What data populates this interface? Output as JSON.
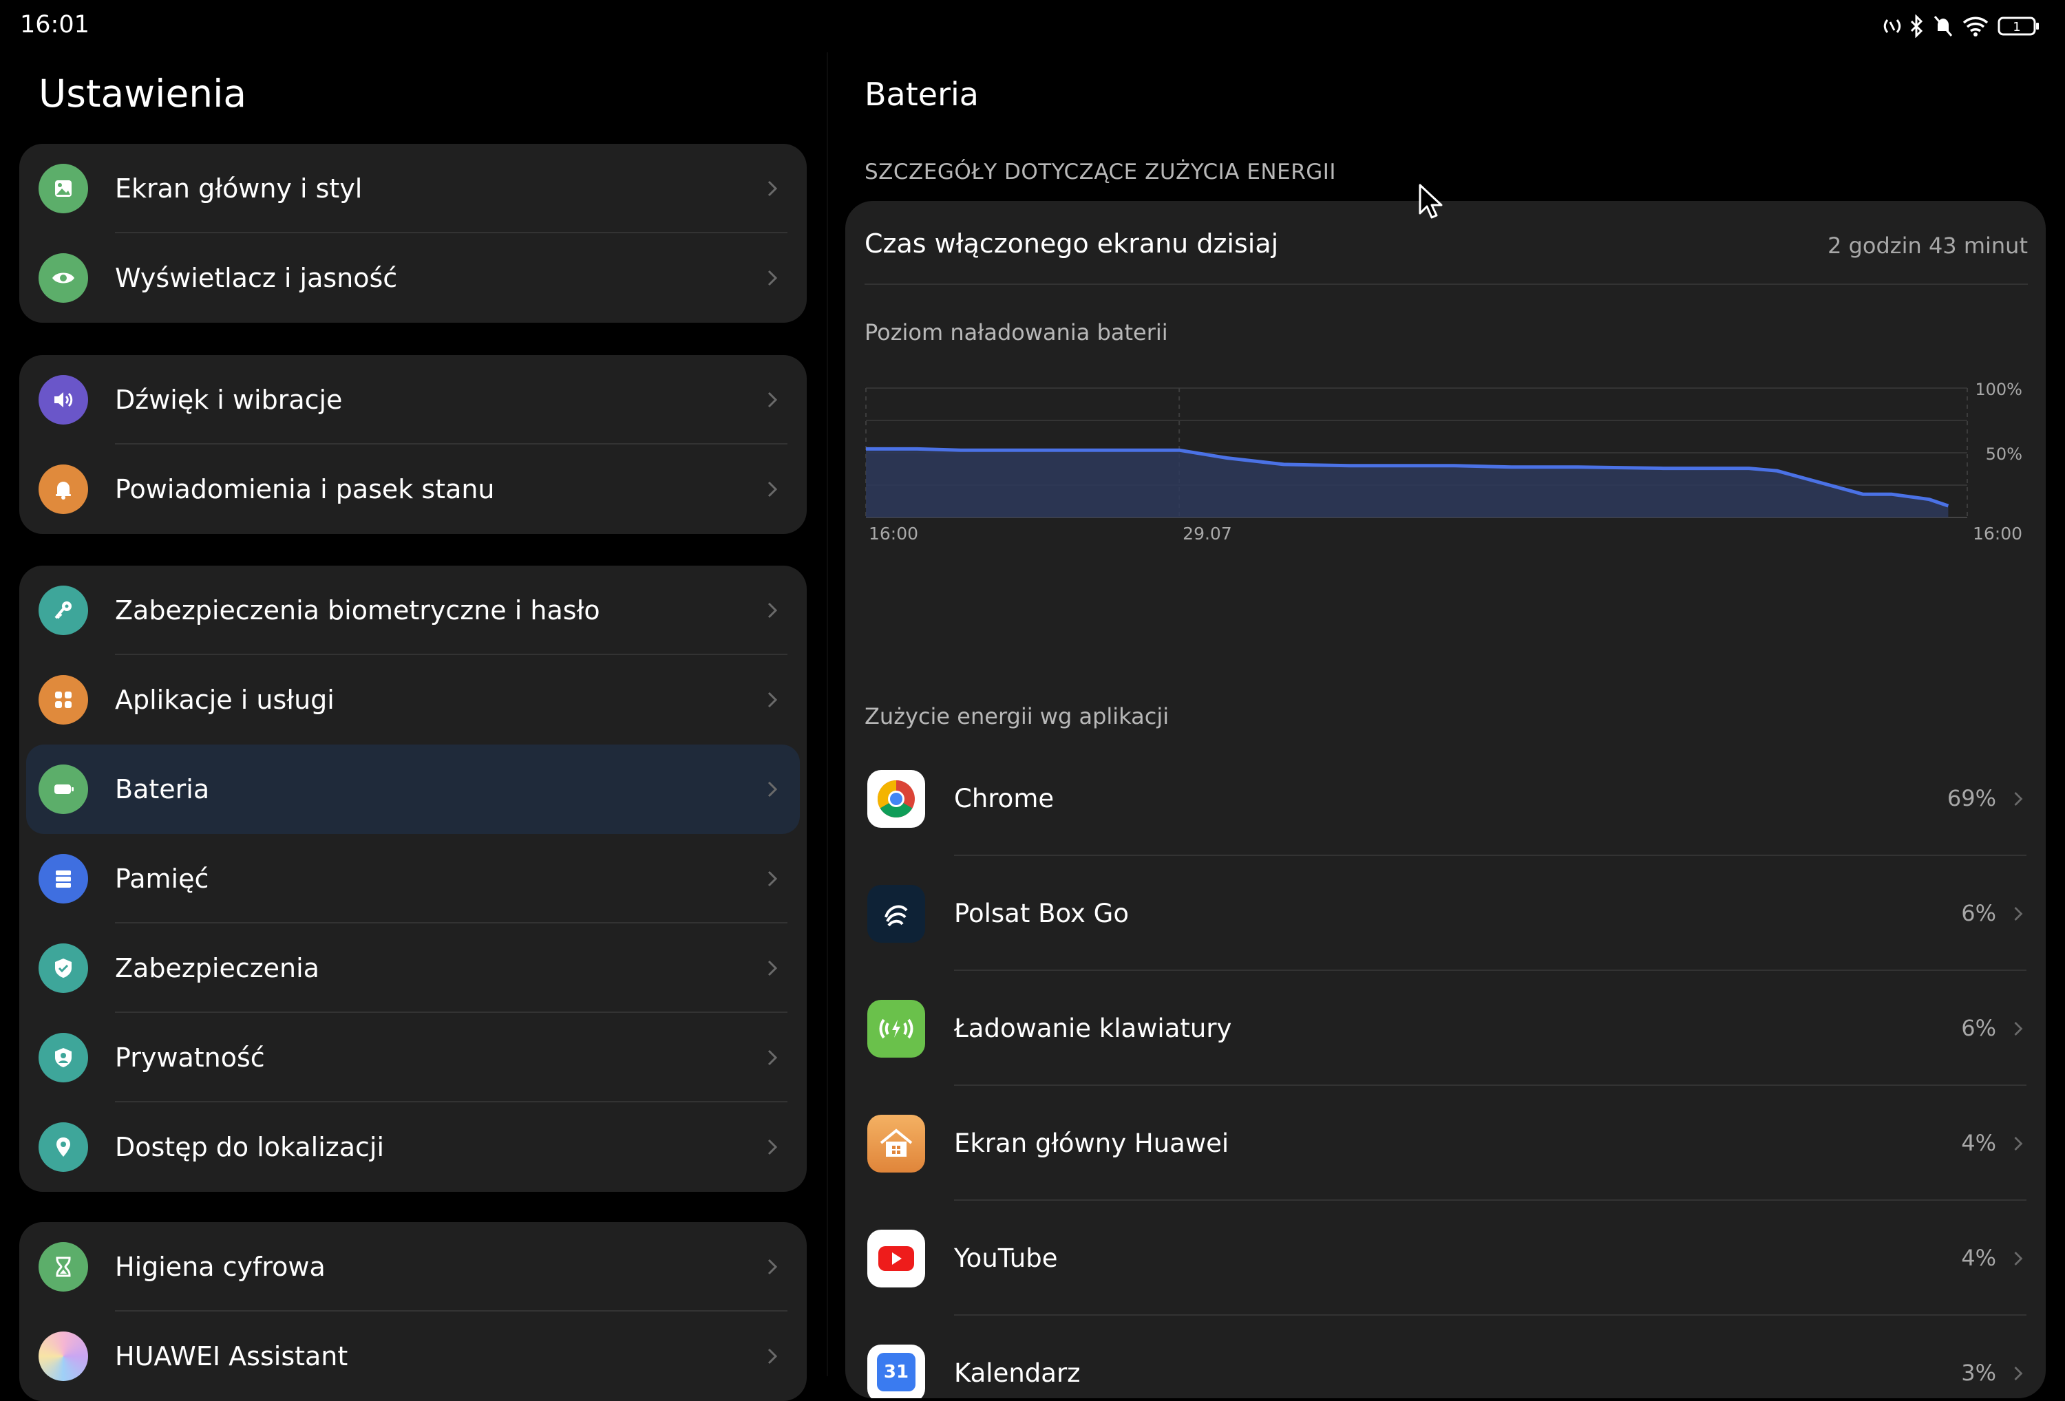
{
  "status_bar": {
    "time": "16:01",
    "battery_level": "1"
  },
  "settings": {
    "title": "Ustawienia",
    "groups": [
      {
        "items": [
          {
            "label": "Ekran główny i styl",
            "icon": "image-icon",
            "color": "#5cae6a"
          },
          {
            "label": "Wyświetlacz i jasność",
            "icon": "eye-icon",
            "color": "#5cae6a"
          }
        ]
      },
      {
        "items": [
          {
            "label": "Dźwięk i wibracje",
            "icon": "speaker-icon",
            "color": "#6a56c9"
          },
          {
            "label": "Powiadomienia i pasek stanu",
            "icon": "bell-icon",
            "color": "#e08a3c"
          }
        ]
      },
      {
        "items": [
          {
            "label": "Zabezpieczenia biometryczne i hasło",
            "icon": "key-icon",
            "color": "#3ea69a"
          },
          {
            "label": "Aplikacje i usługi",
            "icon": "apps-icon",
            "color": "#e08a3c"
          },
          {
            "label": "Bateria",
            "icon": "battery-icon",
            "color": "#5cae6a",
            "active": true
          },
          {
            "label": "Pamięć",
            "icon": "storage-icon",
            "color": "#3f6fe0"
          },
          {
            "label": "Zabezpieczenia",
            "icon": "shield-icon",
            "color": "#3ea69a"
          },
          {
            "label": "Prywatność",
            "icon": "privacy-icon",
            "color": "#3ea69a"
          },
          {
            "label": "Dostęp do lokalizacji",
            "icon": "location-icon",
            "color": "#3ea69a"
          }
        ]
      },
      {
        "items": [
          {
            "label": "Higiena cyfrowa",
            "icon": "hourglass-icon",
            "color": "#5cae6a"
          },
          {
            "label": "HUAWEI Assistant",
            "icon": "assistant-icon",
            "color": "#c7a0e8"
          }
        ]
      }
    ]
  },
  "battery": {
    "title": "Bateria",
    "section_caption": "SZCZEGÓŁY DOTYCZĄCE ZUŻYCIA ENERGII",
    "screen_time_label": "Czas włączonego ekranu dzisiaj",
    "screen_time_value": "2 godzin 43 minut",
    "chart_title": "Poziom naładowania baterii",
    "apps_title": "Zużycie energii wg aplikacji",
    "apps": [
      {
        "name": "Chrome",
        "pct": "69%",
        "icon": "chrome-icon"
      },
      {
        "name": "Polsat Box Go",
        "pct": "6%",
        "icon": "polsat-icon"
      },
      {
        "name": "Ładowanie klawiatury",
        "pct": "6%",
        "icon": "keyboard-charging-icon"
      },
      {
        "name": "Ekran główny Huawei",
        "pct": "4%",
        "icon": "home-icon"
      },
      {
        "name": "YouTube",
        "pct": "4%",
        "icon": "youtube-icon"
      },
      {
        "name": "Kalendarz",
        "pct": "3%",
        "icon": "calendar-icon",
        "icon_text": "31"
      }
    ]
  },
  "chart_data": {
    "type": "area",
    "title": "",
    "x_tick_labels": [
      "16:00",
      "29.07",
      "16:00"
    ],
    "y_tick_labels": [
      "100%",
      "50%"
    ],
    "ylim": [
      0,
      100
    ],
    "x": [
      0,
      0.27,
      0.5,
      1.35,
      1.65,
      1.9,
      2.2,
      2.55,
      3.1,
      3.4,
      3.75,
      4.2,
      4.5,
      4.65,
      4.8,
      4.95,
      5.25,
      5.4,
      5.6,
      5.7
    ],
    "xlim": [
      0,
      5.8
    ],
    "values": [
      53,
      53,
      52,
      52,
      52,
      46,
      41,
      40,
      40,
      39,
      39,
      38,
      38,
      38,
      36,
      30,
      18,
      18,
      14,
      9
    ],
    "grid": true,
    "color": "#4b72e6",
    "fill": "#2e3a5c"
  },
  "colors": {
    "accent": "#4b72e6",
    "active_row": "#1f2a3a",
    "card": "#202020"
  }
}
